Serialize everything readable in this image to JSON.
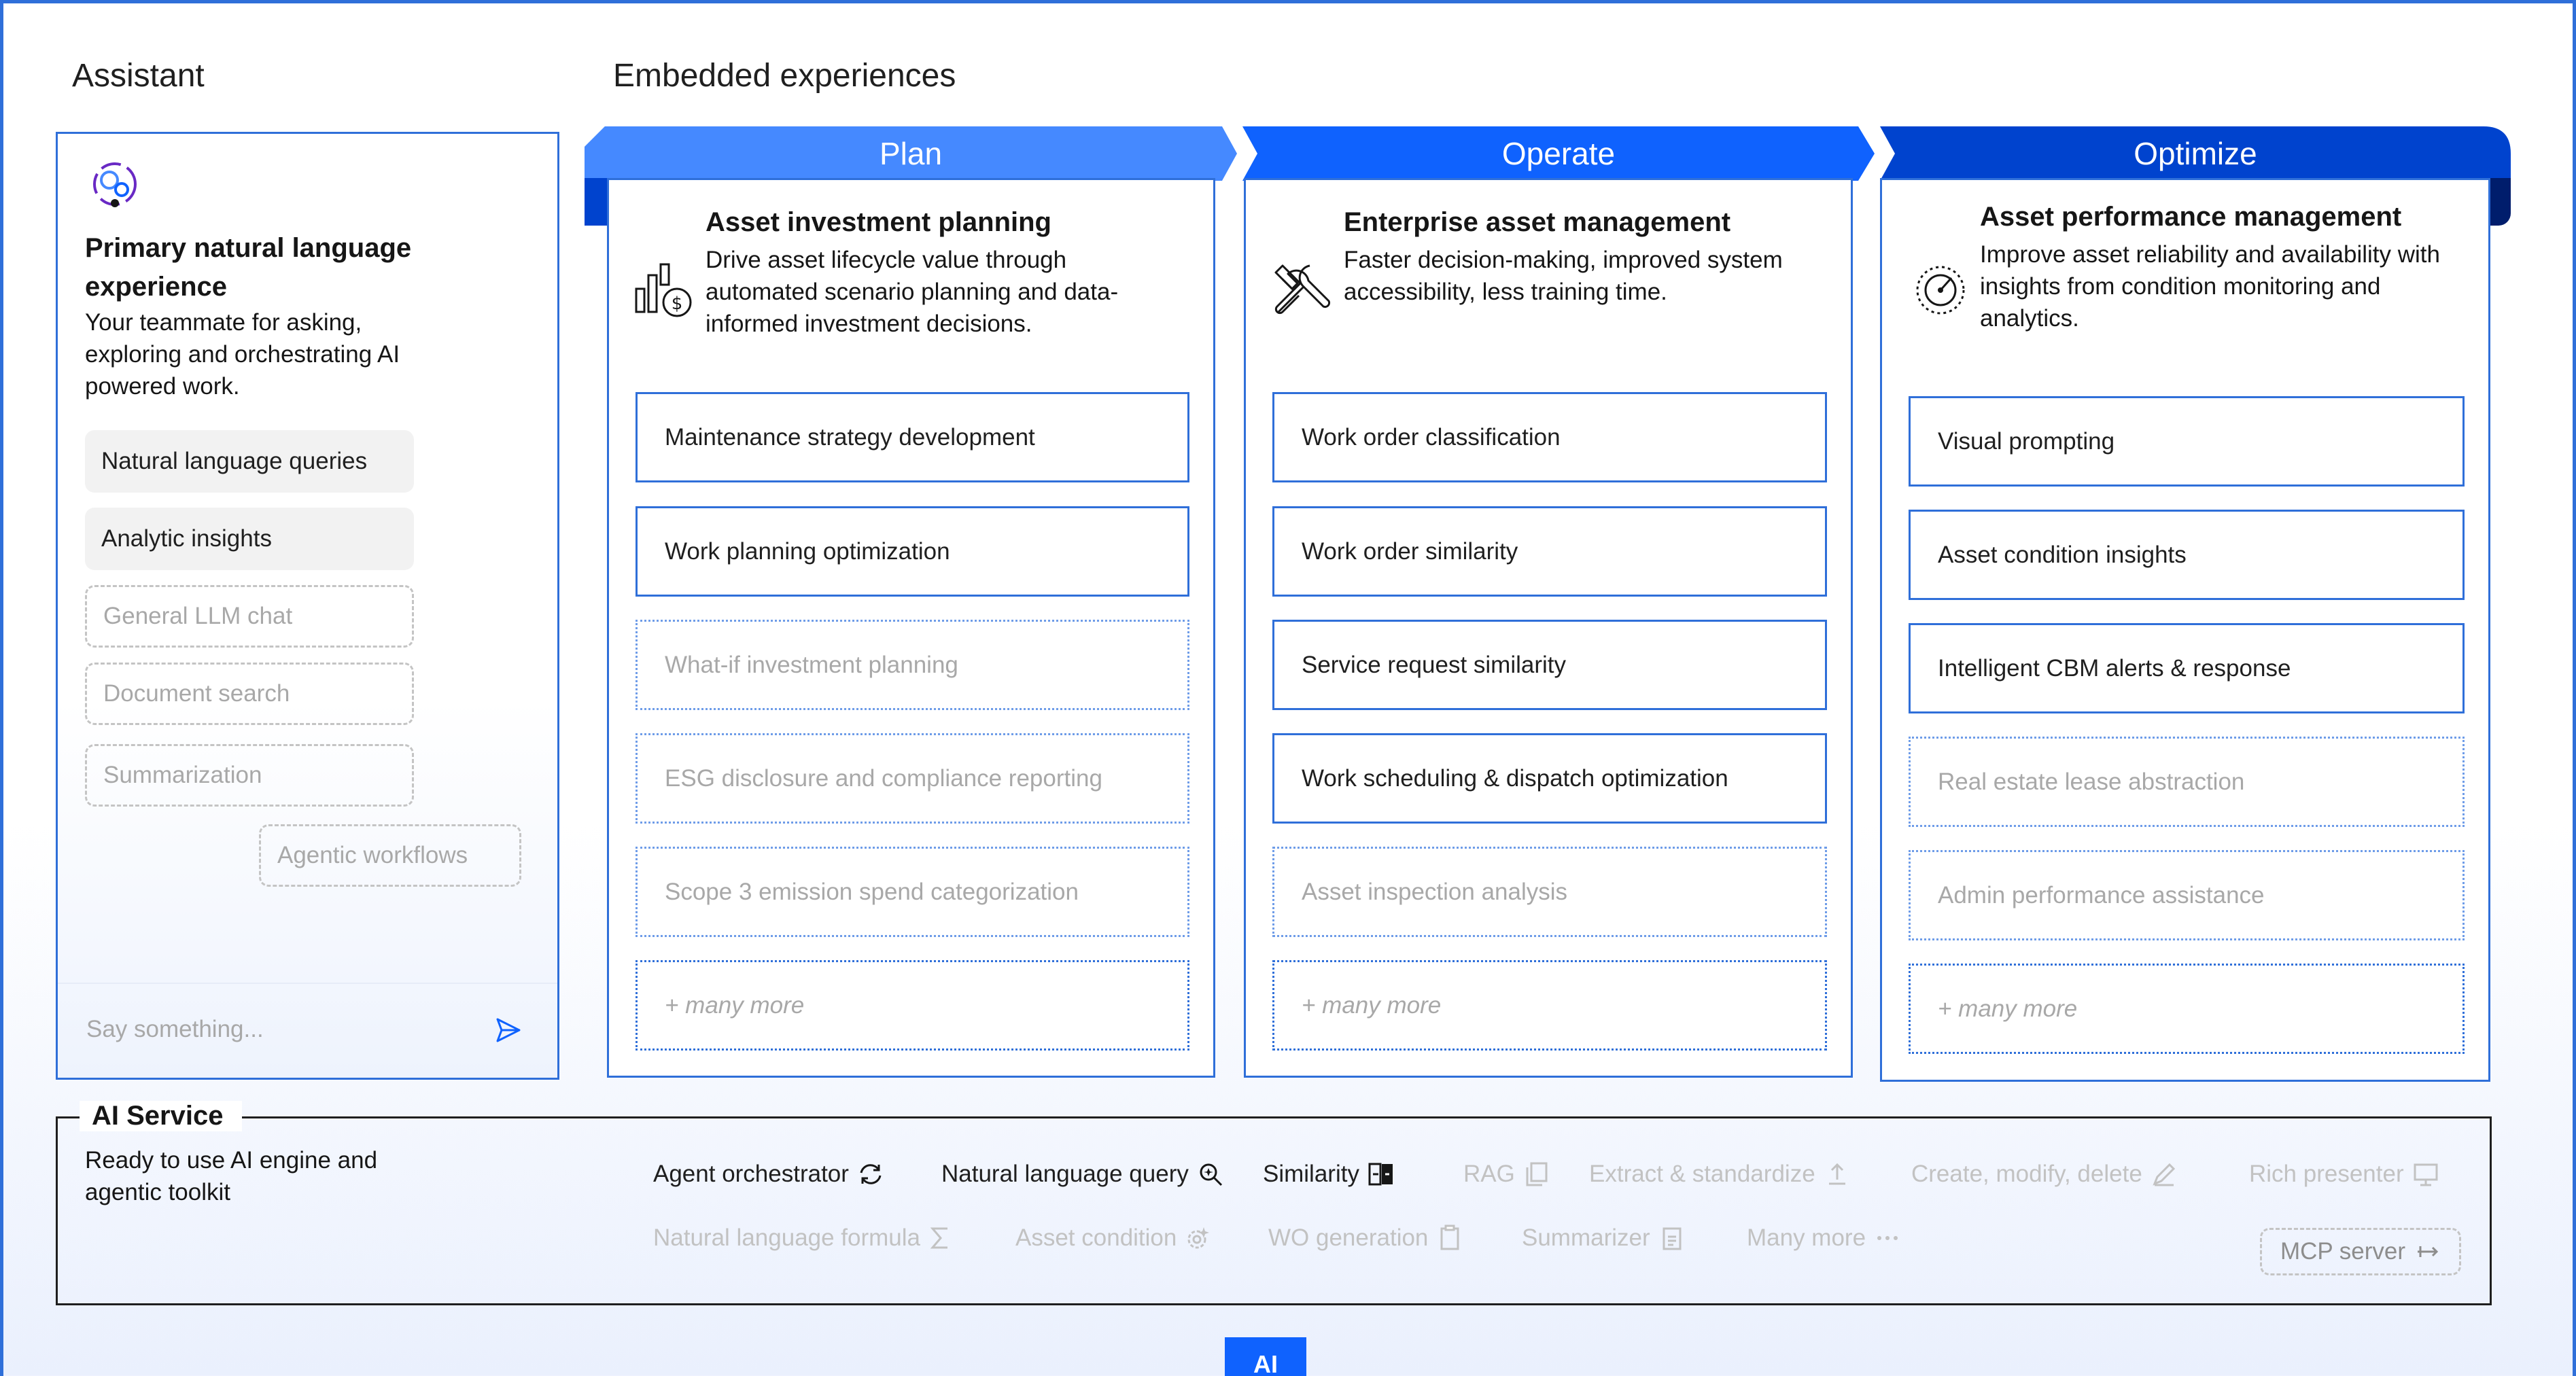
{
  "assistant": {
    "section_label": "Assistant",
    "logo_icon": "assistant-orbit-icon",
    "title": "Primary natural language experience",
    "description": "Your teammate for asking, exploring and orchestrating AI powered work.",
    "chips": [
      {
        "label": "Natural language queries",
        "style": "solid"
      },
      {
        "label": "Analytic insights",
        "style": "solid"
      },
      {
        "label": "General LLM chat",
        "style": "dashed"
      },
      {
        "label": "Document search",
        "style": "dashed"
      },
      {
        "label": "Summarization",
        "style": "dashed"
      },
      {
        "label": "Agentic workflows",
        "style": "dashed"
      }
    ],
    "input_placeholder": "Say something...",
    "send_icon": "send-icon"
  },
  "embedded": {
    "section_label": "Embedded experiences",
    "columns": [
      {
        "header": "Plan",
        "header_color": "#4589ff",
        "icon": "chart-dollar-icon",
        "title": "Asset investment planning",
        "description": "Drive asset lifecycle value through automated scenario planning and data-informed investment decisions.",
        "items": [
          {
            "label": "Maintenance strategy development",
            "style": "solid"
          },
          {
            "label": "Work planning optimization",
            "style": "solid"
          },
          {
            "label": "What-if investment planning",
            "style": "dotted"
          },
          {
            "label": "ESG disclosure and compliance reporting",
            "style": "dotted"
          },
          {
            "label": "Scope 3 emission spend categorization",
            "style": "dotted"
          },
          {
            "label": "+ many more",
            "style": "more"
          }
        ]
      },
      {
        "header": "Operate",
        "header_color": "#0f62fe",
        "icon": "tools-icon",
        "title": "Enterprise asset management",
        "description": "Faster decision-making, improved system accessibility, less training time.",
        "items": [
          {
            "label": "Work order classification",
            "style": "solid"
          },
          {
            "label": "Work order similarity",
            "style": "solid"
          },
          {
            "label": "Service request similarity",
            "style": "solid"
          },
          {
            "label": "Work scheduling & dispatch optimization",
            "style": "solid"
          },
          {
            "label": "Asset inspection analysis",
            "style": "dotted"
          },
          {
            "label": "+ many more",
            "style": "more"
          }
        ]
      },
      {
        "header": "Optimize",
        "header_color": "#0043ce",
        "icon": "gauge-icon",
        "title": "Asset performance management",
        "description": "Improve asset reliability and availability with insights from condition monitoring and analytics.",
        "items": [
          {
            "label": "Visual prompting",
            "style": "solid"
          },
          {
            "label": "Asset condition insights",
            "style": "solid"
          },
          {
            "label": "Intelligent CBM alerts & response",
            "style": "solid"
          },
          {
            "label": "Real estate lease abstraction",
            "style": "dotted"
          },
          {
            "label": "Admin performance assistance",
            "style": "dotted"
          },
          {
            "label": "+ many more",
            "style": "more"
          }
        ]
      }
    ]
  },
  "ai_service": {
    "title": "AI Service",
    "description": "Ready to use AI engine and agentic toolkit",
    "tools_row1": [
      {
        "label": "Agent orchestrator",
        "icon": "refresh-cycle-icon",
        "active": true
      },
      {
        "label": "Natural language query",
        "icon": "search-sparkle-icon",
        "active": true
      },
      {
        "label": "Similarity",
        "icon": "compare-icon",
        "active": true
      },
      {
        "label": "RAG",
        "icon": "copy-document-icon",
        "active": false
      },
      {
        "label": "Extract & standardize",
        "icon": "upload-icon",
        "active": false
      },
      {
        "label": "Create, modify, delete",
        "icon": "edit-pencil-icon",
        "active": false
      },
      {
        "label": "Rich presenter",
        "icon": "presentation-icon",
        "active": false
      }
    ],
    "tools_row2": [
      {
        "label": "Natural language formula",
        "icon": "sigma-icon",
        "active": false
      },
      {
        "label": "Asset condition",
        "icon": "condition-gear-icon",
        "active": false
      },
      {
        "label": "WO generation",
        "icon": "clipboard-icon",
        "active": false
      },
      {
        "label": "Summarizer",
        "icon": "clipboard-list-icon",
        "active": false
      },
      {
        "label": "Many more",
        "icon": "ellipsis-icon",
        "active": false
      }
    ],
    "mcp_label": "MCP server",
    "mcp_icon": "connector-icon"
  },
  "bottom_tab": "AI"
}
